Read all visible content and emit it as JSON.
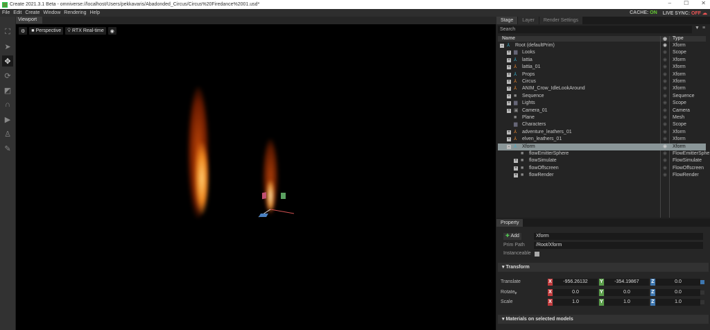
{
  "title": "Create 2021.3.1 Beta - omniverse://localhost/Users/pekkavaris/Abadonded_Circus/Circus%20Firedance%2001.usd*",
  "menu": [
    "File",
    "Edit",
    "Create",
    "Window",
    "Rendering",
    "Help"
  ],
  "status": {
    "cache_label": "CACHE:",
    "cache_value": "ON",
    "sync_label": "LIVE SYNC:",
    "sync_value": "OFF"
  },
  "viewport": {
    "tab": "Viewport",
    "camera": "Perspective",
    "renderer": "RTX Real-time"
  },
  "stage": {
    "tabs": [
      "Stage",
      "Layer",
      "Render Settings"
    ],
    "search_placeholder": "Search",
    "col_name": "Name",
    "col_type": "Type",
    "rows": [
      {
        "name": "Root (defaultPrim)",
        "type": "Xform",
        "depth": 0,
        "exp": "-",
        "icon": "xform"
      },
      {
        "name": "Looks",
        "type": "Scope",
        "depth": 1,
        "exp": "+",
        "icon": "folder"
      },
      {
        "name": "lattia",
        "type": "Xform",
        "depth": 1,
        "exp": "+",
        "icon": "xform"
      },
      {
        "name": "lattia_01",
        "type": "Xform",
        "depth": 1,
        "exp": "+",
        "icon": "char"
      },
      {
        "name": "Props",
        "type": "Xform",
        "depth": 1,
        "exp": "+",
        "icon": "xform"
      },
      {
        "name": "Circus",
        "type": "Xform",
        "depth": 1,
        "exp": "+",
        "icon": "char"
      },
      {
        "name": "ANIM_Crow_IdleLookAround",
        "type": "Xform",
        "depth": 1,
        "exp": "+",
        "icon": "char"
      },
      {
        "name": "Sequence",
        "type": "Sequence",
        "depth": 1,
        "exp": "+",
        "icon": "cube"
      },
      {
        "name": "Lights",
        "type": "Scope",
        "depth": 1,
        "exp": "+",
        "icon": "folder"
      },
      {
        "name": "Camera_01",
        "type": "Camera",
        "depth": 1,
        "exp": "+",
        "icon": "camera"
      },
      {
        "name": "Plane",
        "type": "Mesh",
        "depth": 1,
        "exp": "",
        "icon": "cube"
      },
      {
        "name": "Characters",
        "type": "Scope",
        "depth": 1,
        "exp": "",
        "icon": "folder"
      },
      {
        "name": "adventure_leathers_01",
        "type": "Xform",
        "depth": 1,
        "exp": "+",
        "icon": "char"
      },
      {
        "name": "elven_leathers_01",
        "type": "Xform",
        "depth": 1,
        "exp": "+",
        "icon": "char"
      },
      {
        "name": "Xform",
        "type": "Xform",
        "depth": 1,
        "exp": "-",
        "icon": "xform",
        "selected": true
      },
      {
        "name": "flowEmitterSphere",
        "type": "FlowEmitterSphe",
        "depth": 2,
        "exp": "",
        "icon": "cube"
      },
      {
        "name": "flowSimulate",
        "type": "FlowSimulate",
        "depth": 2,
        "exp": "+",
        "icon": "cube"
      },
      {
        "name": "flowOffscreen",
        "type": "FlowOffscreen",
        "depth": 2,
        "exp": "+",
        "icon": "cube"
      },
      {
        "name": "flowRender",
        "type": "FlowRender",
        "depth": 2,
        "exp": "+",
        "icon": "cube"
      }
    ]
  },
  "property": {
    "tab": "Property",
    "add": "Add",
    "name_value": "Xform",
    "prim_path_label": "Prim Path",
    "prim_path": "/Root/Xform",
    "instanceable_label": "Instanceable",
    "transform_label": "Transform",
    "materials_label": "Materials on selected models",
    "axes": [
      "X",
      "Y",
      "Z"
    ],
    "rows": [
      {
        "label": "Translate",
        "values": [
          "-956.26132",
          "-354.19867",
          "0.0"
        ]
      },
      {
        "label": "Rotate",
        "values": [
          "0.0",
          "0.0",
          "0.0"
        ]
      },
      {
        "label": "Scale",
        "values": [
          "1.0",
          "1.0",
          "1.0"
        ]
      }
    ]
  },
  "colors": {
    "x": "#c0393b",
    "y": "#5a9e4a",
    "z": "#3e77b0"
  }
}
